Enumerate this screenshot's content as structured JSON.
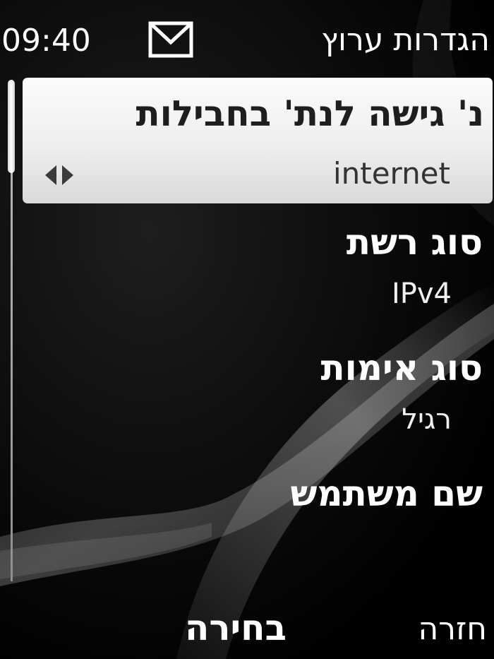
{
  "status_bar": {
    "time": "09:40",
    "message_icon": "envelope-icon",
    "title": "הגדרות ערוץ"
  },
  "settings_list": {
    "items": [
      {
        "label": "נ' גישה לנת' בחבילות",
        "value": "internet",
        "selected": true
      },
      {
        "label": "סוג רשת",
        "value": "IPv4",
        "selected": false
      },
      {
        "label": "סוג אימות",
        "value": "רגיל",
        "selected": false
      },
      {
        "label": "שם משתמש",
        "value": "",
        "selected": false
      }
    ]
  },
  "softkeys": {
    "select_label": "בחירה",
    "back_label": "חזרה"
  },
  "colors": {
    "background": "#000000",
    "highlight": "#eeeeee",
    "text_primary": "#ffffff",
    "text_highlight": "#1e1e1e"
  }
}
